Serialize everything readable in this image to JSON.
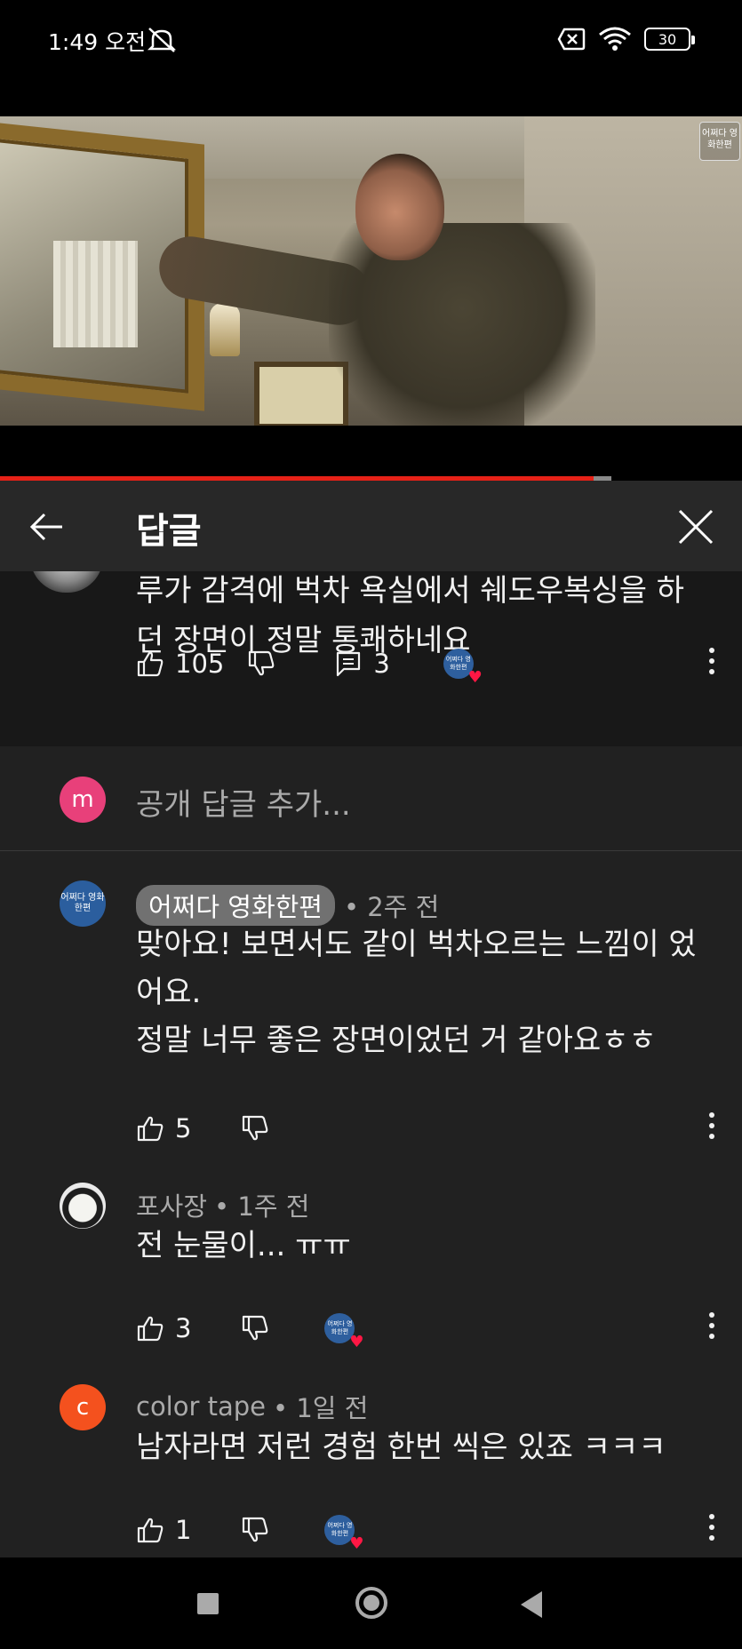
{
  "status_bar": {
    "time": "1:49 오전",
    "battery": "30",
    "icons": [
      "mute-icon",
      "sim-off-icon",
      "wifi-icon",
      "battery-icon"
    ]
  },
  "video": {
    "watermark": "어쩌다 영화한편",
    "progress": 0.8
  },
  "panel": {
    "title": "답글",
    "back_icon": "arrow-left-icon",
    "close_icon": "close-icon"
  },
  "parent_comment": {
    "text": "루가 감격에 벅차 욕실에서 쉐도우복싱을 하던 장면이 정말 통쾌하네요",
    "likes": "105",
    "replies": "3",
    "hearted_by": "어쩌다 영화한편"
  },
  "add_reply": {
    "avatar_letter": "m",
    "placeholder": "공개 답글 추가..."
  },
  "replies": [
    {
      "author": "어쩌다 영화한편",
      "time": "• 2주 전",
      "text": "맞아요! 보면서도 같이 벅차오르는 느낌이 었어요.\n정말 너무 좋은 장면이었던 거 같아요ㅎㅎ",
      "likes": "5",
      "is_owner": true,
      "avatar_text": "어쩌다 영화한편"
    },
    {
      "author": "포사장",
      "time": "• 1주 전",
      "text": "전 눈물이... ㅠㅠ",
      "likes": "3",
      "hearted": true
    },
    {
      "author": "color tape",
      "time": "• 1일 전",
      "text": "남자라면 저런 경험 한번 씩은 있죠 ㅋㅋㅋ",
      "likes": "1",
      "hearted": true,
      "avatar_letter": "c"
    }
  ],
  "colors": {
    "progress": "#e62117",
    "panel_bg": "#212121",
    "header_bg": "#282828",
    "parent_bg": "#181818",
    "heart": "#ff1744"
  }
}
